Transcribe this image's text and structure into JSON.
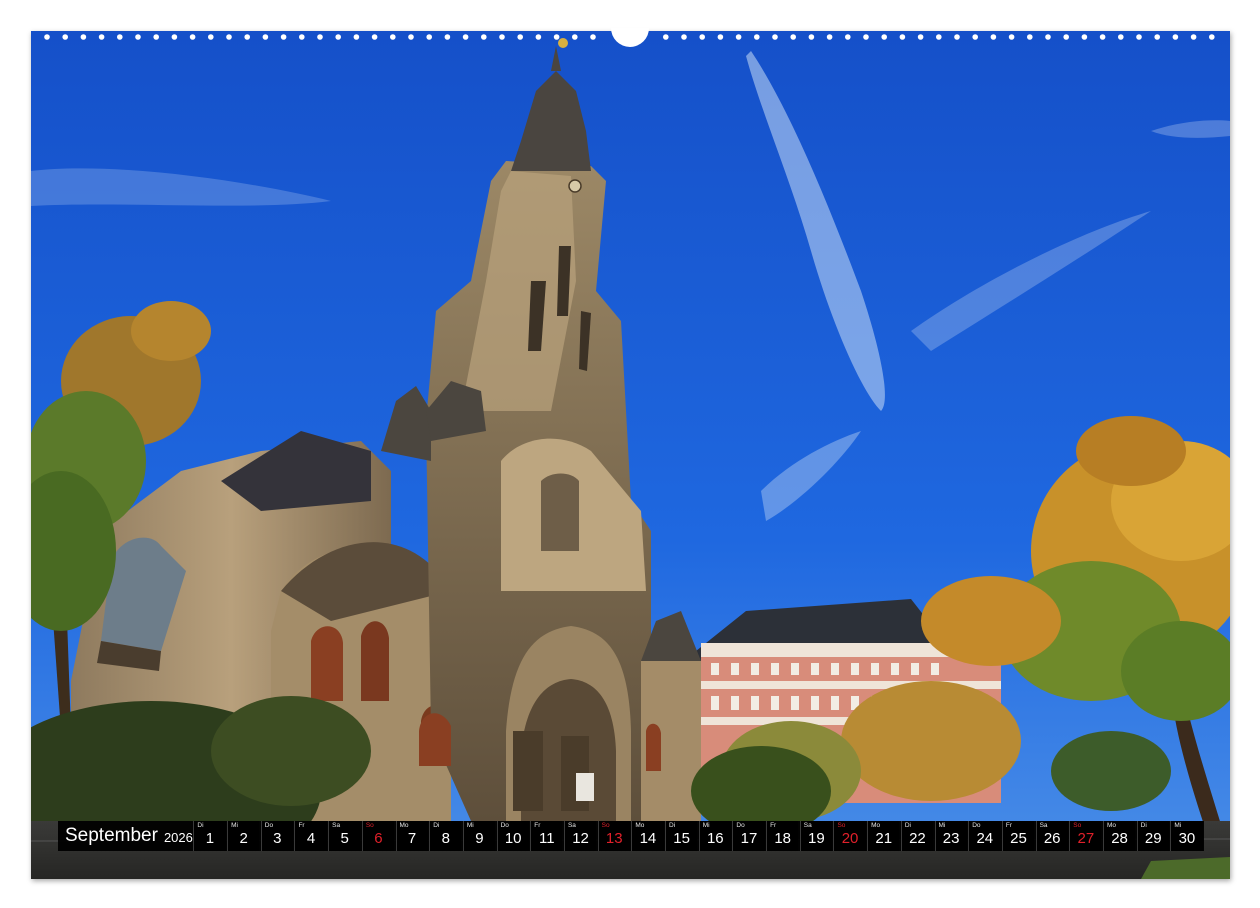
{
  "scene": {
    "description_icon": "church-photo",
    "colors": {
      "sky": "#1f63d8",
      "stone": "#a89271",
      "roof": "#2f2f33",
      "foliage_gold": "#d29a2a",
      "foliage_green": "#4f7a2a",
      "building_pink": "#c9736a"
    }
  },
  "calendar": {
    "month": "September",
    "year": "2026",
    "days": [
      {
        "wd": "Di",
        "n": "1"
      },
      {
        "wd": "Mi",
        "n": "2"
      },
      {
        "wd": "Do",
        "n": "3"
      },
      {
        "wd": "Fr",
        "n": "4"
      },
      {
        "wd": "Sa",
        "n": "5"
      },
      {
        "wd": "So",
        "n": "6",
        "sunday": true
      },
      {
        "wd": "Mo",
        "n": "7"
      },
      {
        "wd": "Di",
        "n": "8"
      },
      {
        "wd": "Mi",
        "n": "9"
      },
      {
        "wd": "Do",
        "n": "10"
      },
      {
        "wd": "Fr",
        "n": "11"
      },
      {
        "wd": "Sa",
        "n": "12"
      },
      {
        "wd": "So",
        "n": "13",
        "sunday": true
      },
      {
        "wd": "Mo",
        "n": "14"
      },
      {
        "wd": "Di",
        "n": "15"
      },
      {
        "wd": "Mi",
        "n": "16"
      },
      {
        "wd": "Do",
        "n": "17"
      },
      {
        "wd": "Fr",
        "n": "18"
      },
      {
        "wd": "Sa",
        "n": "19"
      },
      {
        "wd": "So",
        "n": "20",
        "sunday": true
      },
      {
        "wd": "Mo",
        "n": "21"
      },
      {
        "wd": "Di",
        "n": "22"
      },
      {
        "wd": "Mi",
        "n": "23"
      },
      {
        "wd": "Do",
        "n": "24"
      },
      {
        "wd": "Fr",
        "n": "25"
      },
      {
        "wd": "Sa",
        "n": "26"
      },
      {
        "wd": "So",
        "n": "27",
        "sunday": true
      },
      {
        "wd": "Mo",
        "n": "28"
      },
      {
        "wd": "Di",
        "n": "29"
      },
      {
        "wd": "Mi",
        "n": "30"
      }
    ]
  }
}
